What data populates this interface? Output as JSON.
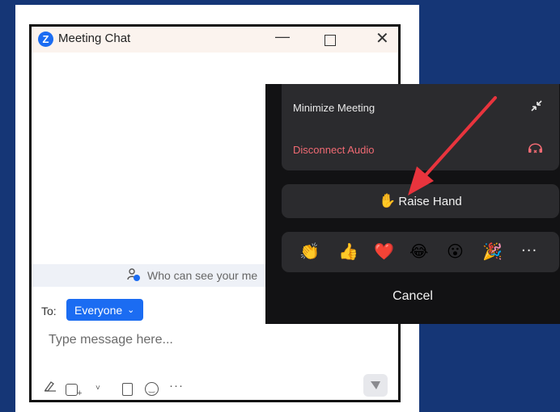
{
  "chat_window": {
    "title": "Meeting Chat",
    "logo_letter": "Z",
    "minimize_glyph": "—",
    "close_glyph": "✕"
  },
  "visibility": {
    "text": "Who can see your me"
  },
  "composer": {
    "to_label": "To:",
    "recipient": "Everyone",
    "recipient_chevron": "⌄",
    "placeholder": "Type message here..."
  },
  "toolbar": {
    "format_icon": "format-icon",
    "screenshot_icon": "screenshot-icon",
    "file_icon": "file-icon",
    "emoji_icon": "emoji-icon",
    "more_glyph": "···",
    "chevron_glyph": "˅"
  },
  "menu": {
    "minimize_label": "Minimize Meeting",
    "minimize_glyph": "↗↙",
    "disconnect_label": "Disconnect Audio",
    "disconnect_glyph": "🎧",
    "raise_hand_emoji": "✋",
    "raise_hand_label": "Raise Hand",
    "reactions": [
      "👏",
      "👍",
      "❤️",
      "😂",
      "😮",
      "🎉"
    ],
    "more_glyph": "···",
    "cancel_label": "Cancel"
  },
  "colors": {
    "background": "#153676",
    "accent_blue": "#1b6cf2",
    "menu_bg": "#121214",
    "menu_card": "#2b2b2e",
    "danger_red": "#f06a73",
    "arrow_red": "#e8343d"
  }
}
